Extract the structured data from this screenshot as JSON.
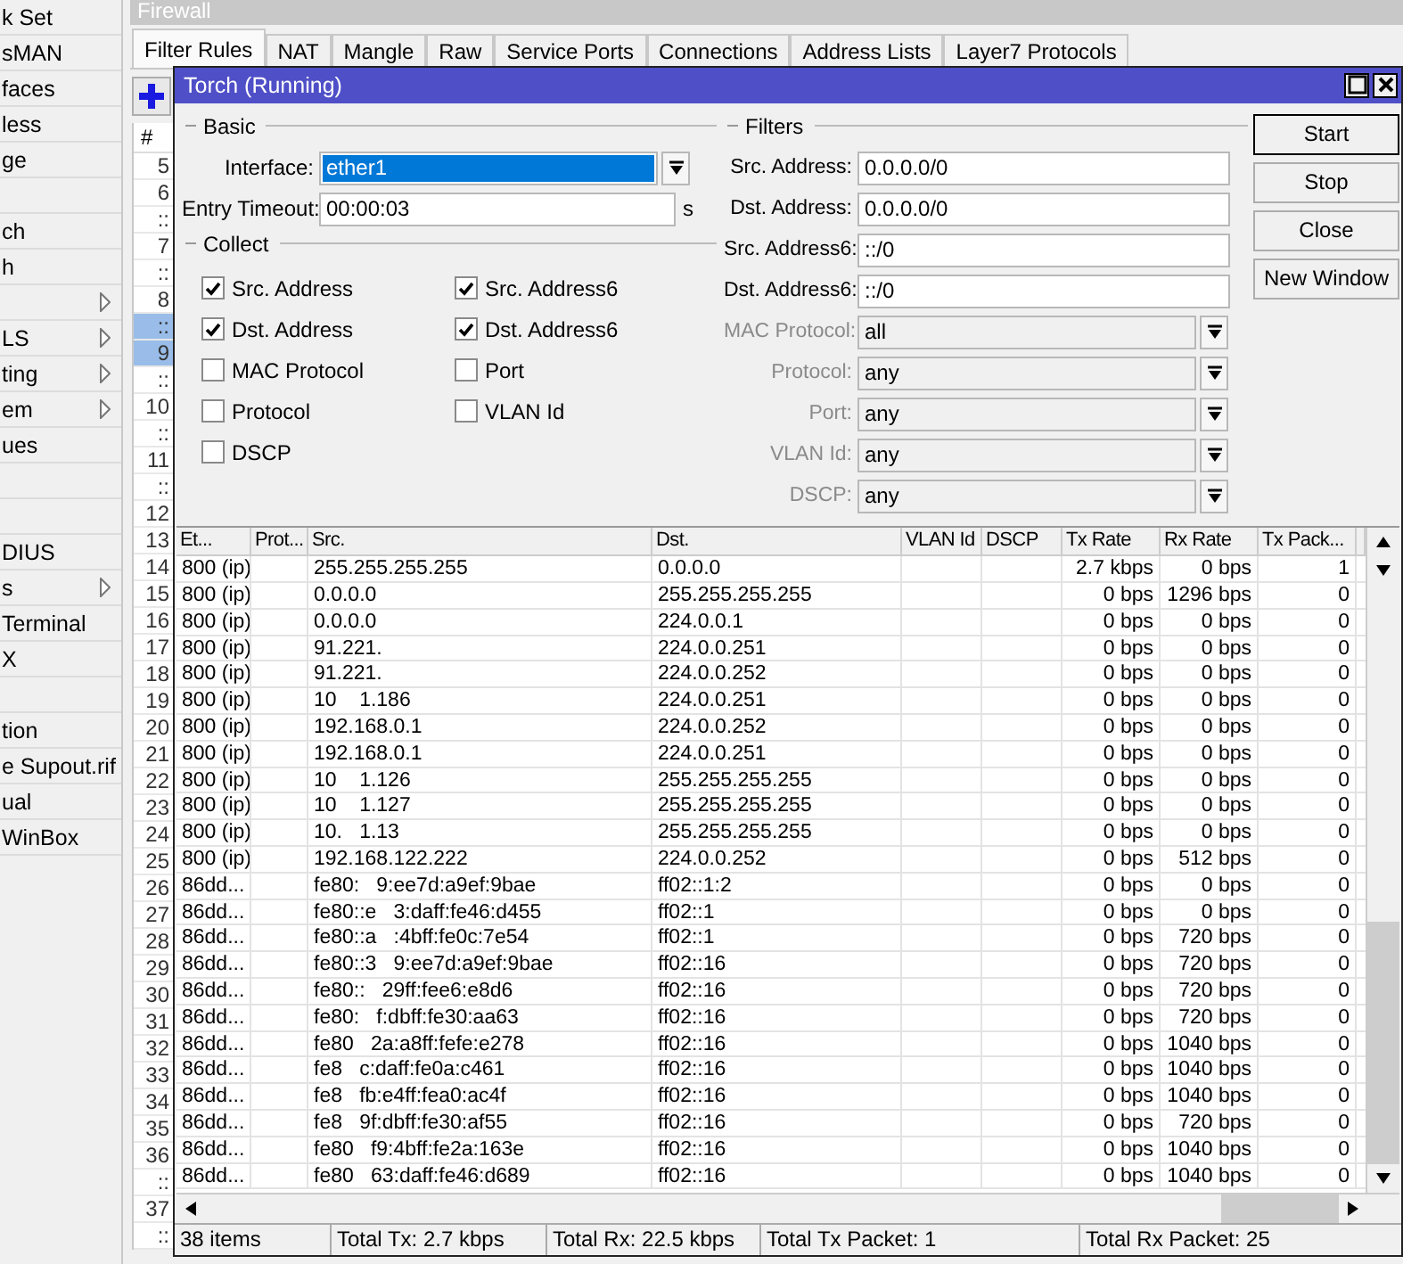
{
  "sidebar": {
    "items": [
      {
        "label": "k Set",
        "has_submenu": false
      },
      {
        "label": "sMAN",
        "has_submenu": false
      },
      {
        "label": "faces",
        "has_submenu": false
      },
      {
        "label": "less",
        "has_submenu": false
      },
      {
        "label": "ge",
        "has_submenu": false
      },
      {
        "has_submenu": false
      },
      {
        "label": "ch",
        "has_submenu": false
      },
      {
        "label": "h",
        "has_submenu": false
      },
      {
        "has_submenu": true
      },
      {
        "label": "LS",
        "has_submenu": true
      },
      {
        "label": "ting",
        "has_submenu": true
      },
      {
        "label": "em",
        "has_submenu": true
      },
      {
        "label": "ues",
        "has_submenu": false
      },
      {
        "has_submenu": false
      },
      {
        "has_submenu": false
      },
      {
        "label": "DIUS",
        "has_submenu": false
      },
      {
        "label": "s",
        "has_submenu": true
      },
      {
        "label": "Terminal",
        "has_submenu": false
      },
      {
        "label": "X",
        "has_submenu": false
      },
      {
        "has_submenu": false
      },
      {
        "label": "tion",
        "has_submenu": false
      },
      {
        "label": "e Supout.rif",
        "has_submenu": false
      },
      {
        "label": "ual",
        "has_submenu": false
      },
      {
        "label": "WinBox",
        "has_submenu": false
      }
    ]
  },
  "firewall": {
    "title": "Firewall",
    "tabs": [
      {
        "label": "Filter Rules",
        "selected": true
      },
      {
        "label": "NAT",
        "selected": false
      },
      {
        "label": "Mangle",
        "selected": false
      },
      {
        "label": "Raw",
        "selected": false
      },
      {
        "label": "Service Ports",
        "selected": false
      },
      {
        "label": "Connections",
        "selected": false
      },
      {
        "label": "Address Lists",
        "selected": false
      },
      {
        "label": "Layer7 Protocols",
        "selected": false
      }
    ],
    "column": "#",
    "rows": [
      {
        "number": "5",
        "selected": false
      },
      {
        "number": "6",
        "selected": false
      },
      {
        "number": "::",
        "selected": false
      },
      {
        "number": "7",
        "selected": false
      },
      {
        "number": "::",
        "selected": false
      },
      {
        "number": "8",
        "selected": false
      },
      {
        "number": "::",
        "selected": true
      },
      {
        "number": "9",
        "selected": true
      },
      {
        "number": "::",
        "selected": false
      },
      {
        "number": "10",
        "selected": false
      },
      {
        "number": "::",
        "selected": false
      },
      {
        "number": "11",
        "selected": false
      },
      {
        "number": "::",
        "selected": false
      },
      {
        "number": "12",
        "selected": false
      },
      {
        "number": "13",
        "selected": false
      },
      {
        "number": "14",
        "selected": false
      },
      {
        "number": "15",
        "selected": false
      },
      {
        "number": "16",
        "selected": false
      },
      {
        "number": "17",
        "selected": false
      },
      {
        "number": "18",
        "selected": false
      },
      {
        "number": "19",
        "selected": false
      },
      {
        "number": "20",
        "selected": false
      },
      {
        "number": "21",
        "selected": false
      },
      {
        "number": "22",
        "selected": false
      },
      {
        "number": "23",
        "selected": false
      },
      {
        "number": "24",
        "selected": false
      },
      {
        "number": "25",
        "selected": false
      },
      {
        "number": "26",
        "selected": false
      },
      {
        "number": "27",
        "selected": false
      },
      {
        "number": "28",
        "selected": false
      },
      {
        "number": "29",
        "selected": false
      },
      {
        "number": "30",
        "selected": false
      },
      {
        "number": "31",
        "selected": false
      },
      {
        "number": "32",
        "selected": false
      },
      {
        "number": "33",
        "selected": false
      },
      {
        "number": "34",
        "selected": false
      },
      {
        "number": "35",
        "selected": false
      },
      {
        "number": "36",
        "selected": false
      },
      {
        "number": "::",
        "selected": false
      },
      {
        "number": "37",
        "selected": false
      },
      {
        "number": "::",
        "selected": false
      }
    ]
  },
  "torch": {
    "title": "Torch (Running)",
    "basic": {
      "title": "Basic",
      "interface_label": "Interface:",
      "interface": "ether1",
      "timeout_label": "Entry Timeout:",
      "timeout": "00:00:03",
      "timeout_unit": "s"
    },
    "collect": {
      "title": "Collect",
      "options": [
        {
          "label": "Src. Address",
          "checked": true
        },
        {
          "label": "Src. Address6",
          "checked": true
        },
        {
          "label": "Dst. Address",
          "checked": true
        },
        {
          "label": "Dst. Address6",
          "checked": true
        },
        {
          "label": "MAC Protocol",
          "checked": false
        },
        {
          "label": "Port",
          "checked": false
        },
        {
          "label": "Protocol",
          "checked": false
        },
        {
          "label": "VLAN Id",
          "checked": false
        },
        {
          "label": "DSCP",
          "checked": false
        }
      ]
    },
    "filters": {
      "title": "Filters",
      "fields": [
        {
          "label": "Src. Address:",
          "value": "0.0.0.0/0",
          "kind": "text",
          "disabled": false
        },
        {
          "label": "Dst. Address:",
          "value": "0.0.0.0/0",
          "kind": "text",
          "disabled": false
        },
        {
          "label": "Src. Address6:",
          "value": "::/0",
          "kind": "text",
          "disabled": false
        },
        {
          "label": "Dst. Address6:",
          "value": "::/0",
          "kind": "text",
          "disabled": false
        },
        {
          "label": "MAC Protocol:",
          "value": "all",
          "kind": "select",
          "disabled": true
        },
        {
          "label": "Protocol:",
          "value": "any",
          "kind": "select",
          "disabled": true
        },
        {
          "label": "Port:",
          "value": "any",
          "kind": "select",
          "disabled": true
        },
        {
          "label": "VLAN Id:",
          "value": "any",
          "kind": "select",
          "disabled": true
        },
        {
          "label": "DSCP:",
          "value": "any",
          "kind": "select",
          "disabled": true
        }
      ]
    },
    "buttons": [
      {
        "label": "Start",
        "default": true
      },
      {
        "label": "Stop",
        "default": false
      },
      {
        "label": "Close",
        "default": false
      },
      {
        "label": "New Window",
        "default": false
      }
    ],
    "table": {
      "columns": [
        "Et...",
        "Prot...",
        "Src.",
        "Dst.",
        "VLAN Id",
        "DSCP",
        "Tx Rate",
        "Rx Rate",
        "Tx Pack..."
      ],
      "rows": [
        [
          "800 (ip)",
          "",
          "255.255.255.255",
          "0.0.0.0",
          "",
          "",
          "2.7 kbps",
          "0 bps",
          "1"
        ],
        [
          "800 (ip)",
          "",
          "0.0.0.0",
          "255.255.255.255",
          "",
          "",
          "0 bps",
          "1296 bps",
          "0"
        ],
        [
          "800 (ip)",
          "",
          "0.0.0.0",
          "224.0.0.1",
          "",
          "",
          "0 bps",
          "0 bps",
          "0"
        ],
        [
          "800 (ip)",
          "",
          "91.221.",
          "224.0.0.251",
          "",
          "",
          "0 bps",
          "0 bps",
          "0"
        ],
        [
          "800 (ip)",
          "",
          "91.221.",
          "224.0.0.252",
          "",
          "",
          "0 bps",
          "0 bps",
          "0"
        ],
        [
          "800 (ip)",
          "",
          "10    1.186",
          "224.0.0.251",
          "",
          "",
          "0 bps",
          "0 bps",
          "0"
        ],
        [
          "800 (ip)",
          "",
          "192.168.0.1",
          "224.0.0.252",
          "",
          "",
          "0 bps",
          "0 bps",
          "0"
        ],
        [
          "800 (ip)",
          "",
          "192.168.0.1",
          "224.0.0.251",
          "",
          "",
          "0 bps",
          "0 bps",
          "0"
        ],
        [
          "800 (ip)",
          "",
          "10    1.126",
          "255.255.255.255",
          "",
          "",
          "0 bps",
          "0 bps",
          "0"
        ],
        [
          "800 (ip)",
          "",
          "10    1.127",
          "255.255.255.255",
          "",
          "",
          "0 bps",
          "0 bps",
          "0"
        ],
        [
          "800 (ip)",
          "",
          "10.   1.13",
          "255.255.255.255",
          "",
          "",
          "0 bps",
          "0 bps",
          "0"
        ],
        [
          "800 (ip)",
          "",
          "192.168.122.222",
          "224.0.0.252",
          "",
          "",
          "0 bps",
          "512 bps",
          "0"
        ],
        [
          "86dd...",
          "",
          "fe80:   9:ee7d:a9ef:9bae",
          "ff02::1:2",
          "",
          "",
          "0 bps",
          "0 bps",
          "0"
        ],
        [
          "86dd...",
          "",
          "fe80::e   3:daff:fe46:d455",
          "ff02::1",
          "",
          "",
          "0 bps",
          "0 bps",
          "0"
        ],
        [
          "86dd...",
          "",
          "fe80::a   :4bff:fe0c:7e54",
          "ff02::1",
          "",
          "",
          "0 bps",
          "720 bps",
          "0"
        ],
        [
          "86dd...",
          "",
          "fe80::3   9:ee7d:a9ef:9bae",
          "ff02::16",
          "",
          "",
          "0 bps",
          "720 bps",
          "0"
        ],
        [
          "86dd...",
          "",
          "fe80::   29ff:fee6:e8d6",
          "ff02::16",
          "",
          "",
          "0 bps",
          "720 bps",
          "0"
        ],
        [
          "86dd...",
          "",
          "fe80:   f:dbff:fe30:aa63",
          "ff02::16",
          "",
          "",
          "0 bps",
          "720 bps",
          "0"
        ],
        [
          "86dd...",
          "",
          "fe80   2a:a8ff:fefe:e278",
          "ff02::16",
          "",
          "",
          "0 bps",
          "1040 bps",
          "0"
        ],
        [
          "86dd...",
          "",
          "fe8   c:daff:fe0a:c461",
          "ff02::16",
          "",
          "",
          "0 bps",
          "1040 bps",
          "0"
        ],
        [
          "86dd...",
          "",
          "fe8   fb:e4ff:fea0:ac4f",
          "ff02::16",
          "",
          "",
          "0 bps",
          "1040 bps",
          "0"
        ],
        [
          "86dd...",
          "",
          "fe8   9f:dbff:fe30:af55",
          "ff02::16",
          "",
          "",
          "0 bps",
          "720 bps",
          "0"
        ],
        [
          "86dd...",
          "",
          "fe80   f9:4bff:fe2a:163e",
          "ff02::16",
          "",
          "",
          "0 bps",
          "1040 bps",
          "0"
        ],
        [
          "86dd...",
          "",
          "fe80   63:daff:fe46:d689",
          "ff02::16",
          "",
          "",
          "0 bps",
          "1040 bps",
          "0"
        ]
      ]
    },
    "status_bar": [
      "38 items",
      "Total Tx: 2.7 kbps",
      "Total Rx: 22.5 kbps",
      "Total Tx Packet: 1",
      "Total Rx Packet: 25"
    ]
  }
}
